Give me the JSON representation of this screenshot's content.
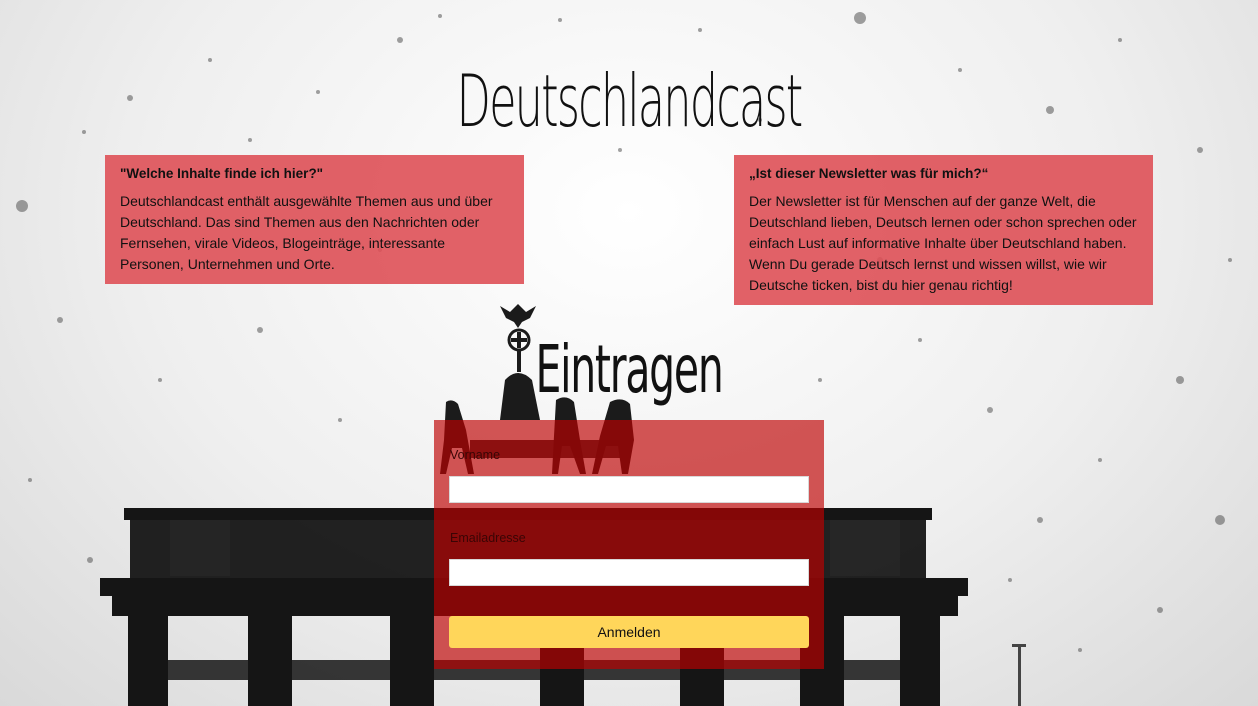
{
  "site": {
    "title": "Deutschlandcast"
  },
  "info_left": {
    "question": "\"Welche Inhalte finde ich hier?\"",
    "text": "Deutschlandcast enthält ausgewählte Themen aus und über Deutschland. Das sind Themen aus den Nachrichten oder Fernsehen, virale Videos, Blogeinträge, interessante Personen, Unternehmen und Orte."
  },
  "info_right": {
    "question": "„Ist dieser Newsletter was für mich?“",
    "text": "Der Newsletter ist für Menschen auf der ganze Welt, die Deutschland lieben, Deutsch lernen oder schon sprechen oder einfach Lust auf informative Inhalte über Deutschland haben. Wenn Du gerade Deutsch lernst und wissen willst, wie wir Deutsche ticken, bist du hier genau richtig!"
  },
  "signup": {
    "heading": "Eintragen",
    "first_name_label": "Vorname",
    "first_name_value": "",
    "email_label": "Emailadresse",
    "email_value": "",
    "submit_label": "Anmelden"
  },
  "colors": {
    "info_box": "#de5056",
    "form_panel": "#be0000",
    "submit_button": "#ffd65a"
  },
  "icons": {
    "background": "brandenburg-gate-background-image"
  }
}
